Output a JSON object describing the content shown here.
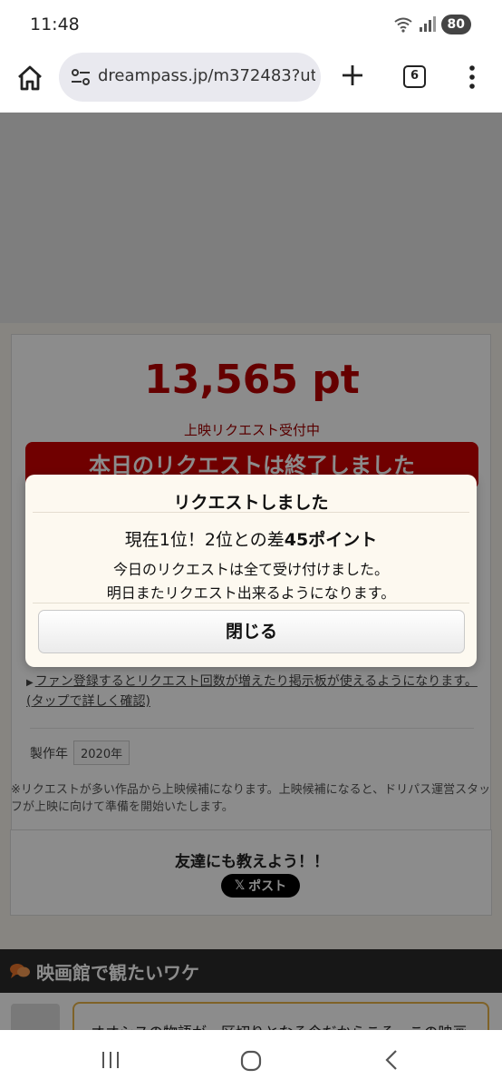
{
  "status_bar": {
    "time": "11:48",
    "wifi_label": "5",
    "battery": "80"
  },
  "browser": {
    "url": "dreampass.jp/m372483?utm_c",
    "tab_count": "6",
    "icons": [
      "home-icon",
      "tune-icon",
      "plus-icon",
      "tabs-icon",
      "more-vert-icon"
    ]
  },
  "page": {
    "points": "13,565 pt",
    "status_label": "上映リクエスト受付中",
    "request_done_banner": "本日のリクエストは終了しました",
    "fan_note": "ファン登録するとリクエスト回数が増えたり掲示板が使えるようになります。(タップで詳しく確認)",
    "year_label": "製作年",
    "year_value": "2020年",
    "request_note": "※リクエストが多い作品から上映候補になります。上映候補になると、ドリパス運営スタッフが上映に向けて準備を開始いたします。",
    "share_title": "友達にも教えよう！！",
    "post_button": "ポスト",
    "section_title": "映画館で観たいワケ",
    "review_excerpt": "オオシスの物語が一区切りとなる今だからこそ、この映画"
  },
  "modal": {
    "title": "リクエストしました",
    "rank_prefix": "現在1位！2位との差",
    "rank_diff": "45ポイント",
    "line1": "今日のリクエストは全て受け付けました。",
    "line2": "明日またリクエスト出来るようになります。",
    "close_button": "閉じる"
  },
  "colors": {
    "points_red": "#b80000",
    "banner_red": "#cc0000",
    "overlay": "rgba(0,0,0,0.45)",
    "modal_bg": "#fdf9f0"
  }
}
